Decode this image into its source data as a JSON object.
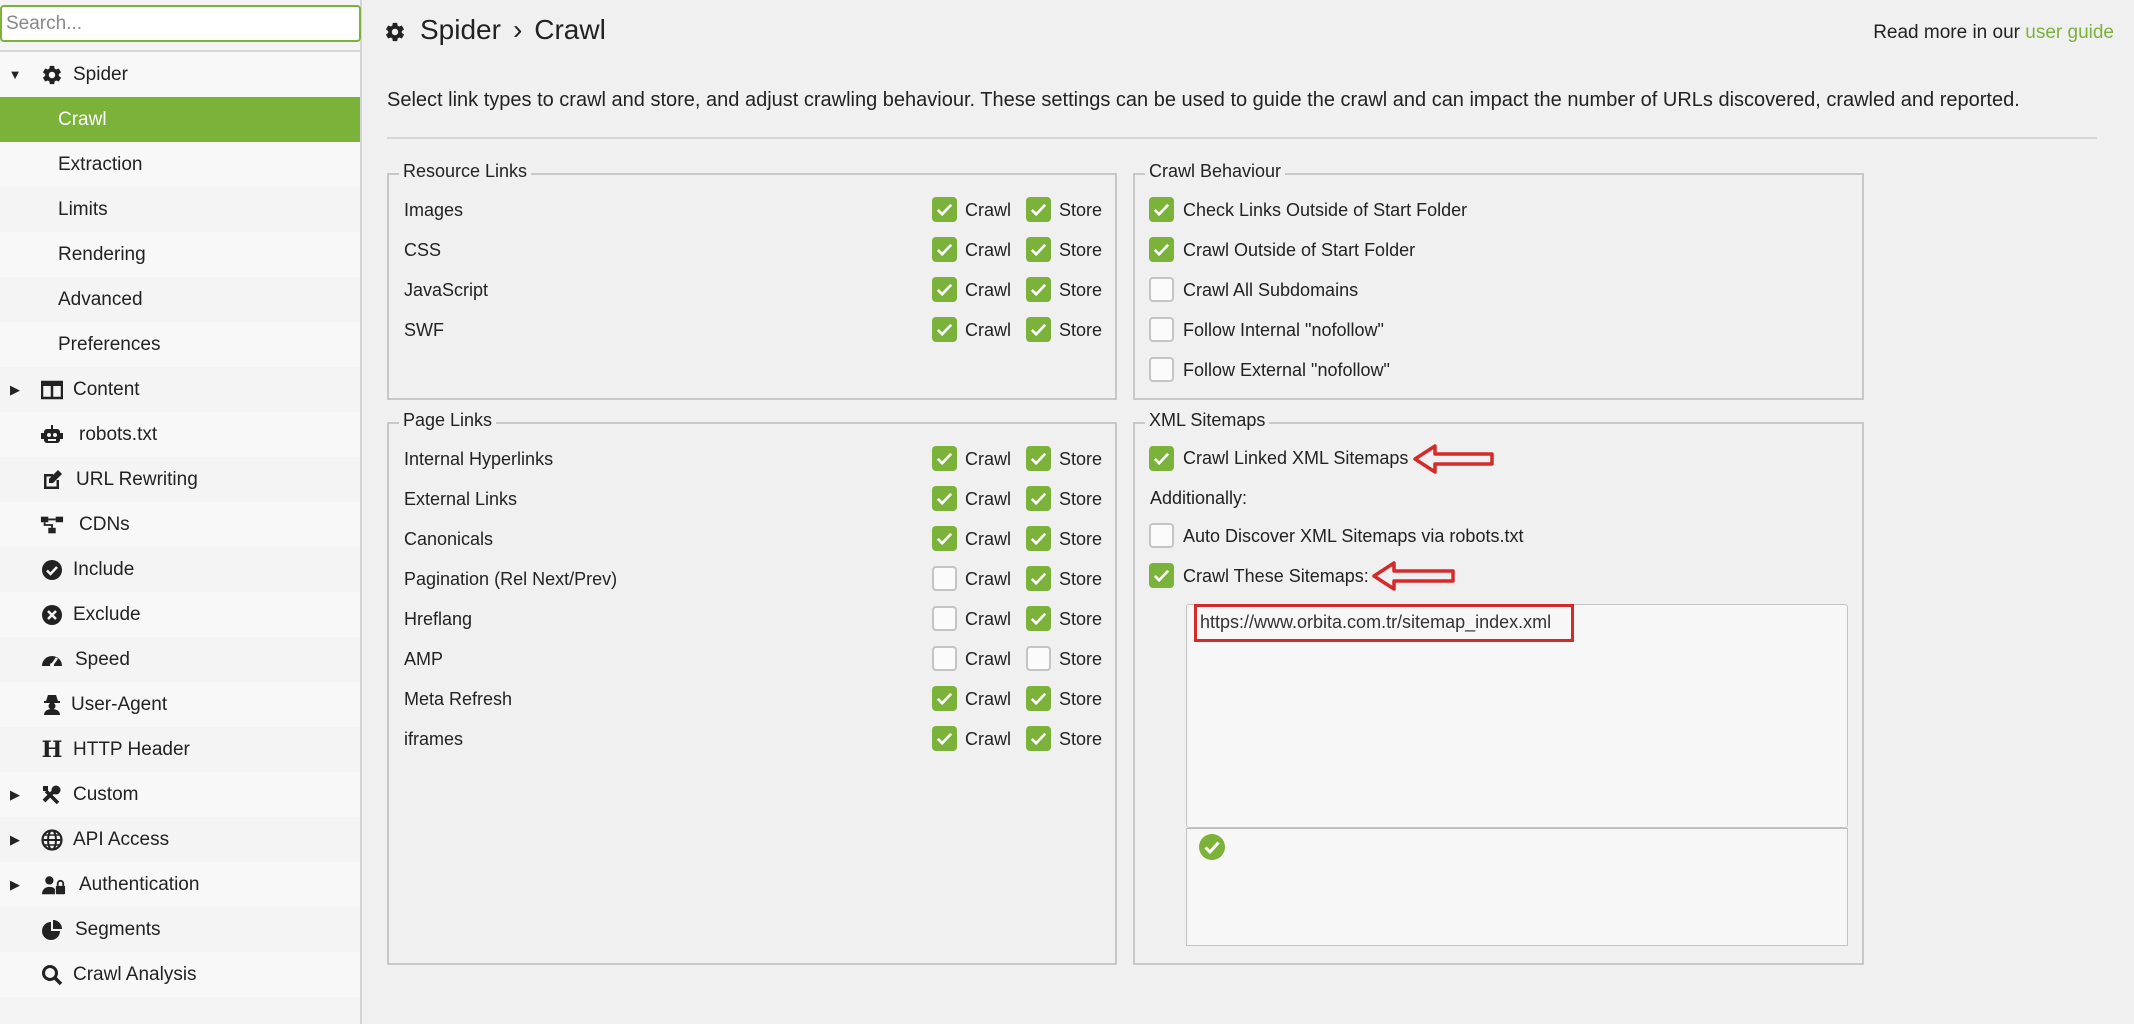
{
  "search": {
    "placeholder": "Search..."
  },
  "sidebar": {
    "items": [
      {
        "label": "Spider",
        "icon": "gear-icon",
        "expanded": true
      },
      {
        "label": "Crawl",
        "active": true
      },
      {
        "label": "Extraction"
      },
      {
        "label": "Limits"
      },
      {
        "label": "Rendering"
      },
      {
        "label": "Advanced"
      },
      {
        "label": "Preferences"
      },
      {
        "label": "Content",
        "icon": "columns-icon"
      },
      {
        "label": "robots.txt",
        "icon": "robot-icon"
      },
      {
        "label": "URL Rewriting",
        "icon": "edit-icon"
      },
      {
        "label": "CDNs",
        "icon": "network-icon"
      },
      {
        "label": "Include",
        "icon": "check-circle-icon"
      },
      {
        "label": "Exclude",
        "icon": "x-circle-icon"
      },
      {
        "label": "Speed",
        "icon": "speedometer-icon"
      },
      {
        "label": "User-Agent",
        "icon": "user-secret-icon"
      },
      {
        "label": "HTTP Header",
        "icon": "heading-icon"
      },
      {
        "label": "Custom",
        "icon": "tools-icon"
      },
      {
        "label": "API Access",
        "icon": "globe-icon"
      },
      {
        "label": "Authentication",
        "icon": "user-lock-icon"
      },
      {
        "label": "Segments",
        "icon": "pie-icon"
      },
      {
        "label": "Crawl Analysis",
        "icon": "search-icon"
      }
    ]
  },
  "header": {
    "section": "Spider",
    "separator": "›",
    "page": "Crawl",
    "read_more_prefix": "Read more in our ",
    "read_more_link": "user guide",
    "description": "Select link types to crawl and store, and adjust crawling behaviour. These settings can be used to guide the crawl and can impact the number of URLs discovered, crawled and reported."
  },
  "resource_links": {
    "title": "Resource Links",
    "crawl_label": "Crawl",
    "store_label": "Store",
    "rows": [
      {
        "label": "Images",
        "crawl": true,
        "store": true
      },
      {
        "label": "CSS",
        "crawl": true,
        "store": true
      },
      {
        "label": "JavaScript",
        "crawl": true,
        "store": true
      },
      {
        "label": "SWF",
        "crawl": true,
        "store": true
      }
    ]
  },
  "page_links": {
    "title": "Page Links",
    "crawl_label": "Crawl",
    "store_label": "Store",
    "rows": [
      {
        "label": "Internal Hyperlinks",
        "crawl": true,
        "store": true
      },
      {
        "label": "External Links",
        "crawl": true,
        "store": true
      },
      {
        "label": "Canonicals",
        "crawl": true,
        "store": true
      },
      {
        "label": "Pagination (Rel Next/Prev)",
        "crawl": false,
        "store": true
      },
      {
        "label": "Hreflang",
        "crawl": false,
        "store": true
      },
      {
        "label": "AMP",
        "crawl": false,
        "store": false
      },
      {
        "label": "Meta Refresh",
        "crawl": true,
        "store": true
      },
      {
        "label": "iframes",
        "crawl": true,
        "store": true
      }
    ]
  },
  "crawl_behaviour": {
    "title": "Crawl Behaviour",
    "options": [
      {
        "label": "Check Links Outside of Start Folder",
        "checked": true
      },
      {
        "label": "Crawl Outside of Start Folder",
        "checked": true
      },
      {
        "label": "Crawl All Subdomains",
        "checked": false
      },
      {
        "label": "Follow Internal \"nofollow\"",
        "checked": false
      },
      {
        "label": "Follow External \"nofollow\"",
        "checked": false
      }
    ]
  },
  "xml_sitemaps": {
    "title": "XML Sitemaps",
    "crawl_linked": {
      "label": "Crawl Linked XML Sitemaps",
      "checked": true
    },
    "additionally": "Additionally:",
    "auto_discover": {
      "label": "Auto Discover XML Sitemaps via robots.txt",
      "checked": false
    },
    "crawl_these": {
      "label": "Crawl These Sitemaps:",
      "checked": true
    },
    "sitemap_url": "https://www.orbita.com.tr/sitemap_index.xml",
    "status_icon": "valid-check-icon"
  },
  "colors": {
    "accent": "#7ab23a",
    "annotation_red": "#d42a2a"
  }
}
